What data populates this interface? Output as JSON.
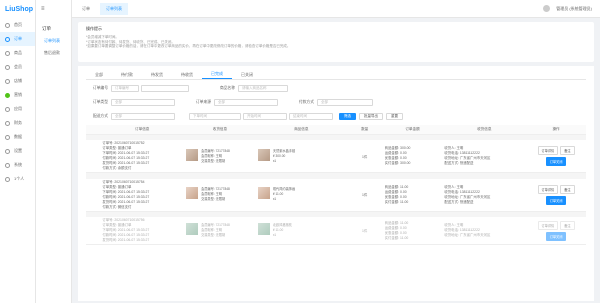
{
  "app": {
    "logo": "LiuShop"
  },
  "sidebar": {
    "items": [
      {
        "label": "首页",
        "icon": "home-icon",
        "active": false
      },
      {
        "label": "订单",
        "icon": "order-icon",
        "active": true
      },
      {
        "label": "商品",
        "icon": "goods-icon",
        "active": false
      },
      {
        "label": "会员",
        "icon": "member-icon",
        "active": false
      },
      {
        "label": "店铺",
        "icon": "shop-icon",
        "active": false
      },
      {
        "label": "营销",
        "icon": "marketing-icon",
        "active": false
      },
      {
        "label": "应用",
        "icon": "app-icon",
        "active": false
      },
      {
        "label": "财务",
        "icon": "finance-icon",
        "active": false
      },
      {
        "label": "数据",
        "icon": "data-icon",
        "active": false
      },
      {
        "label": "设置",
        "icon": "settings-icon",
        "active": false
      },
      {
        "label": "系统",
        "icon": "system-icon",
        "active": false
      },
      {
        "label": "1个人",
        "icon": "user-icon",
        "active": false
      }
    ]
  },
  "subnav": {
    "collapse": "≡",
    "group": "订单",
    "items": [
      {
        "label": "订单列表",
        "active": true
      },
      {
        "label": "售后退款",
        "active": false
      }
    ]
  },
  "topbar": {
    "tabs": [
      {
        "label": "订单",
        "active": false
      },
      {
        "label": "订单列表",
        "active": true
      }
    ],
    "user": "管理员 (系统管理员)"
  },
  "tips": {
    "title": "操作提示",
    "lines": [
      "*会员增减下单时间。",
      "*订单状态有待付款、待发货、待收货、已完成、已关闭。",
      "*如果要订单要调整订单价格的话，请在订单中更改订单商品的实价，再在订单中更改修改订单的价格，请检查订单价格是否已完成。"
    ]
  },
  "status_tabs": [
    "全部",
    "待付款",
    "待发货",
    "待收货",
    "已完成",
    "已关闭"
  ],
  "status_tab_active": 4,
  "filters": {
    "order_no_label": "订单编号",
    "order_no_select": "订单编号",
    "goods_label": "商品名称",
    "goods_placeholder": "请输入商品名称",
    "order_type_label": "订单类型",
    "order_type_value": "全部",
    "order_source_label": "订单来源",
    "order_source_value": "全部",
    "pay_label": "付款方式",
    "pay_value": "全部",
    "delivery_label": "配送方式",
    "delivery_value": "全部",
    "time_select": "下单时间",
    "time_start": "开始时间",
    "time_end": "结束时间",
    "search_button": "筛选",
    "export_button": "批量导出",
    "reset_button": "重置"
  },
  "table": {
    "headers": [
      "",
      "订单信息",
      "收货信息",
      "商品信息",
      "数量",
      "订单金额",
      "收货信息",
      "操作"
    ],
    "rows": [
      {
        "top": "",
        "checkbox": "",
        "order_lines": [
          "订单号: 2021060710015752",
          "订单类型: 普通订单",
          "下单时间: 2021-06-07 15:33:27",
          "付款时间: 2021-06-07 15:33:27",
          "发货时间: 2021-06-07 15:33:27",
          "付款方式: 余额支付"
        ],
        "buyer_lines": [
          "会员编号: 72177848",
          "会员昵称: 王明",
          "交易类型: 无限制"
        ],
        "goods_name": "天然紫水晶手链",
        "goods_price": "¥ 300.00",
        "goods_qty": "x1",
        "qty": "1件",
        "amount_lines": [
          "商品金额: 300.00",
          "运费金额: 0.00",
          "优惠金额: 0.00",
          "实付金额: 300.00"
        ],
        "address_lines": [
          "收货人: 王明",
          "收货电话: 13811112222",
          "收货地址: 广东省广州市天河区",
          "配送方式: 快递配送"
        ],
        "ops": [
          "订单详情",
          "备注",
          "订单关闭"
        ]
      },
      {
        "top": "",
        "checkbox": "",
        "order_lines": [
          "订单号: 2021060710015754",
          "订单类型: 普通订单",
          "下单时间: 2021-06-07 15:33:27",
          "付款时间: 2021-06-07 15:33:27",
          "发货时间: 2021-06-07 15:33:27",
          "付款方式: 微信支付"
        ],
        "buyer_lines": [
          "会员编号: 72177848",
          "会员昵称: 王明",
          "交易类型: 无限制"
        ],
        "goods_name": "现代简约装饰画",
        "goods_price": "¥ 11.00",
        "goods_qty": "x1",
        "qty": "1件",
        "amount_lines": [
          "商品金额: 11.00",
          "运费金额: 0.00",
          "优惠金额: 0.00",
          "实付金额: 11.00"
        ],
        "address_lines": [
          "收货人: 王明",
          "收货电话: 13811112222",
          "收货地址: 广东省广州市天河区",
          "配送方式: 快递配送"
        ],
        "ops": [
          "订单详情",
          "备注",
          "订单关闭"
        ]
      },
      {
        "top": "",
        "checkbox": "",
        "order_lines": [
          "订单号: 2021060710015756",
          "订单类型: 普通订单",
          "下单时间: 2021-06-07 15:33:27",
          "付款时间: 2021-06-07 15:33:27",
          "发货时间: 2021-06-07 15:33:27"
        ],
        "buyer_lines": [
          "会员编号: 72177848",
          "会员昵称: 王明",
          "交易类型: 无限制"
        ],
        "goods_name": "北欧风格抱枕",
        "goods_price": "¥ 11.00",
        "goods_qty": "x1",
        "qty": "1件",
        "amount_lines": [
          "商品金额: 11.00",
          "运费金额: 0.00",
          "优惠金额: 0.00",
          "实付金额: 11.00"
        ],
        "address_lines": [
          "收货人: 王明",
          "收货电话: 13811112222",
          "收货地址: 广东省广州市天河区"
        ],
        "ops": [
          "订单详情",
          "备注",
          "订单关闭"
        ]
      }
    ]
  }
}
